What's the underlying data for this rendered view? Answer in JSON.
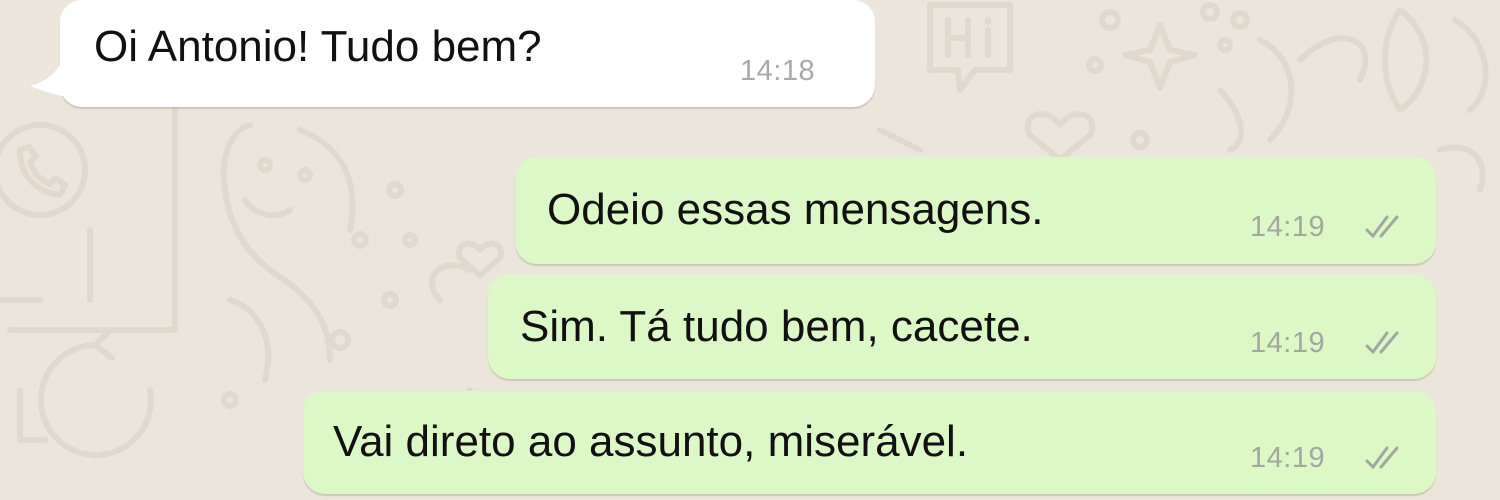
{
  "chat": {
    "messages": [
      {
        "direction": "incoming",
        "text": "Oi Antonio! Tudo bem?",
        "time": "14:18"
      },
      {
        "direction": "outgoing",
        "text": "Odeio essas mensagens.",
        "time": "14:19",
        "status": "delivered-double-check"
      },
      {
        "direction": "outgoing",
        "text": "Sim. Tá tudo bem, cacete.",
        "time": "14:19",
        "status": "delivered-double-check"
      },
      {
        "direction": "outgoing",
        "text": "Vai direto ao assunto, miserável.",
        "time": "14:19",
        "status": "delivered-double-check"
      }
    ]
  },
  "colors": {
    "wallpaper": "#ece5dc",
    "incoming_bubble": "#ffffff",
    "outgoing_bubble": "#dcf8c6",
    "timestamp": "#a2a8a0"
  },
  "icons": {
    "status": "double-check-icon",
    "wallpaper_doodles": [
      "hi-speech-bubble-icon",
      "sparkle-star-icon",
      "phone-icon",
      "cactus-icon",
      "heart-icon",
      "refresh-arrow-icon"
    ]
  }
}
